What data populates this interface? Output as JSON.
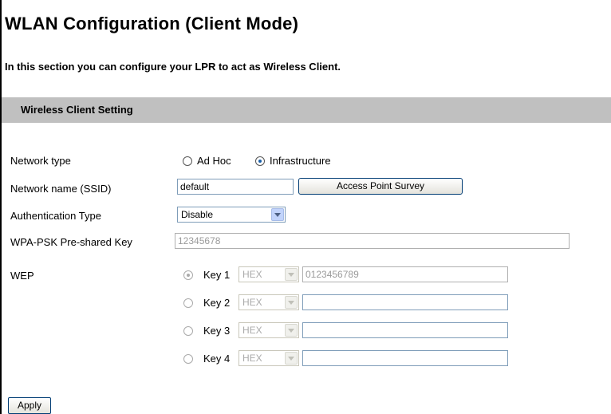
{
  "page": {
    "title": "WLAN Configuration (Client Mode)",
    "description": "In this section you can configure your LPR to act as Wireless Client.",
    "section_title": "Wireless Client Setting"
  },
  "form": {
    "network_type": {
      "label": "Network type",
      "options": [
        "Ad Hoc",
        "Infrastructure"
      ],
      "selected": "Infrastructure"
    },
    "ssid": {
      "label": "Network name (SSID)",
      "value": "default",
      "survey_button": "Access Point Survey"
    },
    "auth_type": {
      "label": "Authentication Type",
      "value": "Disable"
    },
    "wpa_psk": {
      "label": "WPA-PSK Pre-shared Key",
      "value": "12345678"
    },
    "wep": {
      "label": "WEP",
      "selected_key": "Key 1",
      "keys": [
        {
          "label": "Key 1",
          "format": "HEX",
          "value": "0123456789"
        },
        {
          "label": "Key 2",
          "format": "HEX",
          "value": ""
        },
        {
          "label": "Key 3",
          "format": "HEX",
          "value": ""
        },
        {
          "label": "Key 4",
          "format": "HEX",
          "value": ""
        }
      ]
    },
    "apply_button": "Apply"
  },
  "colors": {
    "section_bg": "#c0c0c0",
    "radio_dot": "#1a5fa8",
    "input_border": "#7f9db9"
  }
}
